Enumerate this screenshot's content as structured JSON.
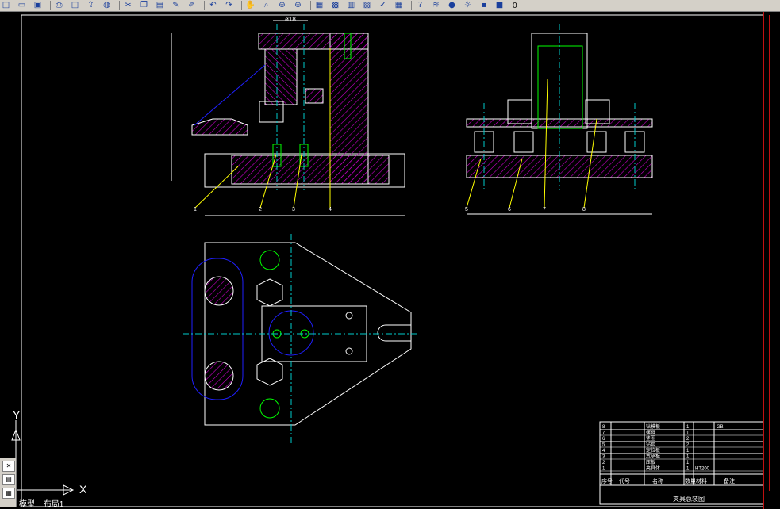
{
  "toolbar": {
    "icons": [
      "new-icon",
      "open-icon",
      "save-icon",
      "print-icon",
      "preview-icon",
      "publish-icon",
      "plot-icon",
      "cut-icon",
      "copy-icon",
      "paste-icon",
      "match-properties-icon",
      "brush-icon",
      "undo-icon",
      "redo-icon",
      "pan-icon",
      "zoom-realtime-icon",
      "zoom-window-icon",
      "zoom-previous-icon",
      "properties-icon",
      "design-center-icon",
      "tool-palette-icon",
      "sheet-set-icon",
      "markup-icon",
      "calculator-icon",
      "help-icon",
      "layer-manager-icon",
      "layer-bulb-icon",
      "layer-sun-icon",
      "layer-lock-icon",
      "layer-color-icon"
    ],
    "layer_name": "0"
  },
  "ucs": {
    "y_label": "Y",
    "x_label": "X"
  },
  "tabs": {
    "model": "模型",
    "layout": "布局1"
  },
  "bom": {
    "title": "夹具总装图",
    "header": {
      "index": "序号",
      "code": "代号",
      "name": "名称",
      "qty": "数量",
      "material": "材料",
      "remark": "备注"
    },
    "rows": [
      {
        "index": "8",
        "name": "钻模板",
        "qty": "1",
        "material": "",
        "remark": "GB"
      },
      {
        "index": "7",
        "name": "螺母",
        "qty": "1",
        "material": "",
        "remark": ""
      },
      {
        "index": "6",
        "name": "垫圈",
        "qty": "2",
        "material": "",
        "remark": ""
      },
      {
        "index": "5",
        "name": "钻套",
        "qty": "2",
        "material": "",
        "remark": ""
      },
      {
        "index": "4",
        "name": "定位板",
        "qty": "1",
        "material": "",
        "remark": ""
      },
      {
        "index": "3",
        "name": "支承板",
        "qty": "1",
        "material": "",
        "remark": ""
      },
      {
        "index": "2",
        "name": "压板",
        "qty": "1",
        "material": "",
        "remark": ""
      },
      {
        "index": "1",
        "name": "夹具体",
        "qty": "1",
        "material": "HT200",
        "remark": ""
      }
    ]
  },
  "dimensions": {
    "front_top_width": "ø18",
    "leaders_front": [
      "1",
      "2",
      "3",
      "4"
    ],
    "leaders_side": [
      "5",
      "6",
      "7",
      "8"
    ]
  },
  "colors": {
    "background": "#000000",
    "outline": "#ffffff",
    "hatch": "#cc00cc",
    "center_line": "#00cccc",
    "hidden": "#00ff00",
    "blue": "#2020ff",
    "leader": "#ffff00",
    "accent_red": "#c01010"
  }
}
